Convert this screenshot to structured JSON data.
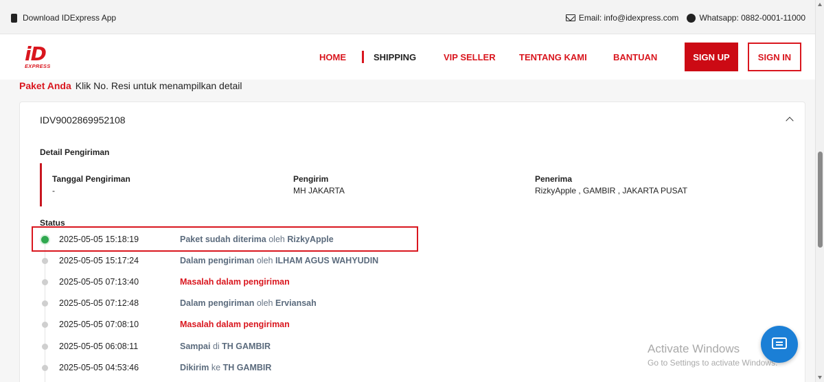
{
  "topbar": {
    "download_app": "Download IDExpress App",
    "email": "Email: info@idexpress.com",
    "whatsapp": "Whatsapp: 0882-0001-11000"
  },
  "logo": {
    "mark": "iD",
    "sub": "EXPRESS"
  },
  "nav": {
    "home": "HOME",
    "shipping": "SHIPPING",
    "vip_seller": "VIP SELLER",
    "tentang_kami": "TENTANG KAMI",
    "bantuan": "BANTUAN",
    "sign_up": "SIGN UP",
    "sign_in": "SIGN IN"
  },
  "paket": {
    "label": "Paket Anda",
    "hint": "Klik No. Resi untuk menampilkan detail"
  },
  "card": {
    "resi": "IDV9002869952108",
    "detail_title": "Detail Pengiriman",
    "tanggal_label": "Tanggal Pengiriman",
    "tanggal_value": "-",
    "pengirim_label": "Pengirim",
    "pengirim_value": "MH JAKARTA",
    "penerima_label": "Penerima",
    "penerima_value": "RizkyApple , GAMBIR , JAKARTA PUSAT",
    "status_title": "Status"
  },
  "timeline": [
    {
      "time": "2025-05-05 15:18:19",
      "main": "Paket sudah diterima",
      "conn": "oleh",
      "who": "RizkyApple",
      "type": "normal"
    },
    {
      "time": "2025-05-05 15:17:24",
      "main": "Dalam pengiriman",
      "conn": "oleh",
      "who": "ILHAM AGUS WAHYUDIN",
      "type": "normal"
    },
    {
      "time": "2025-05-05 07:13:40",
      "main": "Masalah dalam pengiriman",
      "conn": "",
      "who": "",
      "type": "problem"
    },
    {
      "time": "2025-05-05 07:12:48",
      "main": "Dalam pengiriman",
      "conn": "oleh",
      "who": "Erviansah",
      "type": "normal"
    },
    {
      "time": "2025-05-05 07:08:10",
      "main": "Masalah dalam pengiriman",
      "conn": "",
      "who": "",
      "type": "problem"
    },
    {
      "time": "2025-05-05 06:08:11",
      "main": "Sampai",
      "conn": "di",
      "who": "TH GAMBIR",
      "type": "normal"
    },
    {
      "time": "2025-05-05 04:53:46",
      "main": "Dikirim",
      "conn": "ke",
      "who": "TH GAMBIR",
      "type": "normal"
    }
  ],
  "watermark": {
    "line1": "Activate Windows",
    "line2": "Go to Settings to activate Windows."
  },
  "colors": {
    "brand_red": "#d9161e",
    "delivered_green": "#2fa84f",
    "chat_blue": "#1b7fd6"
  }
}
